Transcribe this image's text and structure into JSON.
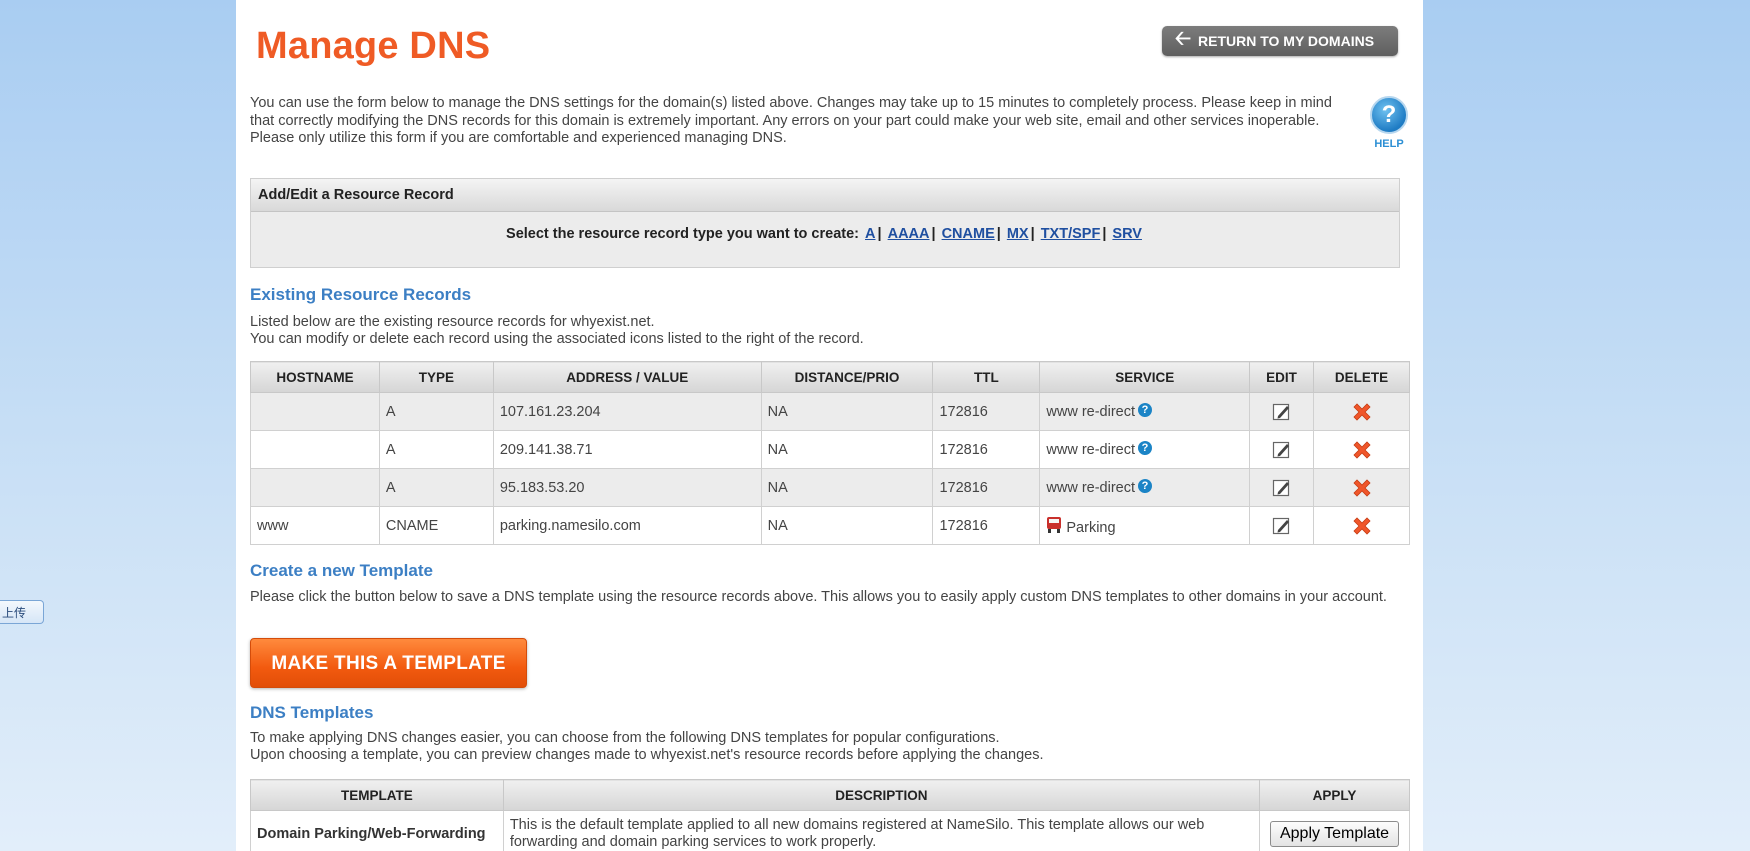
{
  "side_tab": {
    "label": "上传"
  },
  "header": {
    "title": "Manage DNS",
    "return_label": "RETURN TO MY DOMAINS"
  },
  "intro": "You can use the form below to manage the DNS settings for the domain(s) listed above. Changes may take up to 15 minutes to completely process. Please keep in mind that correctly modifying the DNS records for this domain is extremely important. Any errors on your part could make your web site, email and other services inoperable. Please only utilize this form if you are comfortable and experienced managing DNS.",
  "help": {
    "label": "HELP"
  },
  "add_edit": {
    "title": "Add/Edit a Resource Record",
    "prompt": "Select the resource record type you want to create:",
    "types": [
      "A",
      "AAAA",
      "CNAME",
      "MX",
      "TXT/SPF",
      "SRV"
    ]
  },
  "existing": {
    "title": "Existing Resource Records",
    "line1": "Listed below are the existing resource records for whyexist.net.",
    "line2": "You can modify or delete each record using the associated icons listed to the right of the record.",
    "columns": [
      "HOSTNAME",
      "TYPE",
      "ADDRESS / VALUE",
      "DISTANCE/PRIO",
      "TTL",
      "SERVICE",
      "EDIT",
      "DELETE"
    ],
    "rows": [
      {
        "hostname": "",
        "type": "A",
        "value": "107.161.23.204",
        "prio": "NA",
        "ttl": "172816",
        "service": "www re-direct"
      },
      {
        "hostname": "",
        "type": "A",
        "value": "209.141.38.71",
        "prio": "NA",
        "ttl": "172816",
        "service": "www re-direct"
      },
      {
        "hostname": "",
        "type": "A",
        "value": "95.183.53.20",
        "prio": "NA",
        "ttl": "172816",
        "service": "www re-direct"
      },
      {
        "hostname": "www",
        "type": "CNAME",
        "value": "parking.namesilo.com",
        "prio": "NA",
        "ttl": "172816",
        "service": "Parking"
      }
    ]
  },
  "create_template": {
    "title": "Create a new Template",
    "text": "Please click the button below to save a DNS template using the resource records above. This allows you to easily apply custom DNS templates to other domains in your account.",
    "button": "MAKE THIS A TEMPLATE"
  },
  "dns_templates": {
    "title": "DNS Templates",
    "line1": "To make applying DNS changes easier, you can choose from the following DNS templates for popular configurations.",
    "line2": "Upon choosing a template, you can preview changes made to whyexist.net's resource records before applying the changes.",
    "columns": [
      "TEMPLATE",
      "DESCRIPTION",
      "APPLY"
    ],
    "rows": [
      {
        "name": "Domain Parking/Web-Forwarding",
        "description": "This is the default template applied to all new domains registered at NameSilo. This template allows our web forwarding and domain parking services to work properly.",
        "button": "Apply Template"
      }
    ]
  },
  "colors": {
    "title": "#ef5b25",
    "section": "#3c7fc4",
    "link": "#1f4fa0",
    "button": "#f25a0f"
  }
}
